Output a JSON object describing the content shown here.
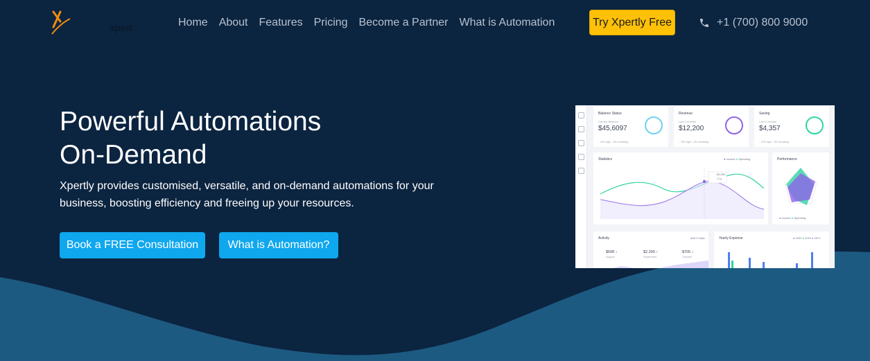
{
  "brand": {
    "logo_text": "xpert"
  },
  "nav": {
    "links": [
      "Home",
      "About",
      "Features",
      "Pricing",
      "Become a Partner",
      "What is Automation"
    ],
    "cta": "Try Xpertly Free",
    "phone": "+1 (700) 800 9000"
  },
  "hero": {
    "title_line1": "Powerful Automations",
    "title_line2": "On-Demand",
    "description": "Xpertly provides customised, versatile, and on-demand automations for your business, boosting efficiency and freeing up your resources.",
    "primary_button": "Book a FREE Consultation",
    "secondary_button": "What is Automation?"
  },
  "dashboard": {
    "cards": [
      {
        "title": "Balance Status",
        "subtitle": "Current Balance",
        "value": "$45,6097",
        "foot": "↑ 15% login  ↓ 8% remaining",
        "accent": "#6dd3f0"
      },
      {
        "title": "Revenue",
        "subtitle": "Last 3 months",
        "value": "$12,200",
        "foot": "↑ 78% login  ↓ 8% remaining",
        "accent": "#8e63e8"
      },
      {
        "title": "Saving",
        "subtitle": "Last 3 months",
        "value": "$4,357",
        "foot": "↑ 15% login  ↓ 8% remaining",
        "accent": "#2fd3a2"
      }
    ],
    "statistics": {
      "title": "Statistics",
      "legend": [
        "Income",
        "Spending"
      ],
      "tooltip_value": "$3,300",
      "tooltip_label": "Aug"
    },
    "performance": {
      "title": "Performance",
      "legend": [
        "Income",
        "Spending"
      ]
    },
    "activity": {
      "title": "Activity",
      "link": "Add 3 Days",
      "values": [
        "$608 ↓",
        "$2,390 ↑",
        "$705 ↓"
      ],
      "labels": [
        "August",
        "September",
        "October"
      ]
    },
    "yearly": {
      "title": "Yearly Expense",
      "legend": [
        "2020",
        "2019",
        "2017"
      ]
    }
  },
  "colors": {
    "background": "#0b2440",
    "wave": "#1d5a82",
    "accent_blue": "#0fa7ee",
    "cta_yellow": "#ffc107",
    "logo_orange": "#f28c0f"
  }
}
